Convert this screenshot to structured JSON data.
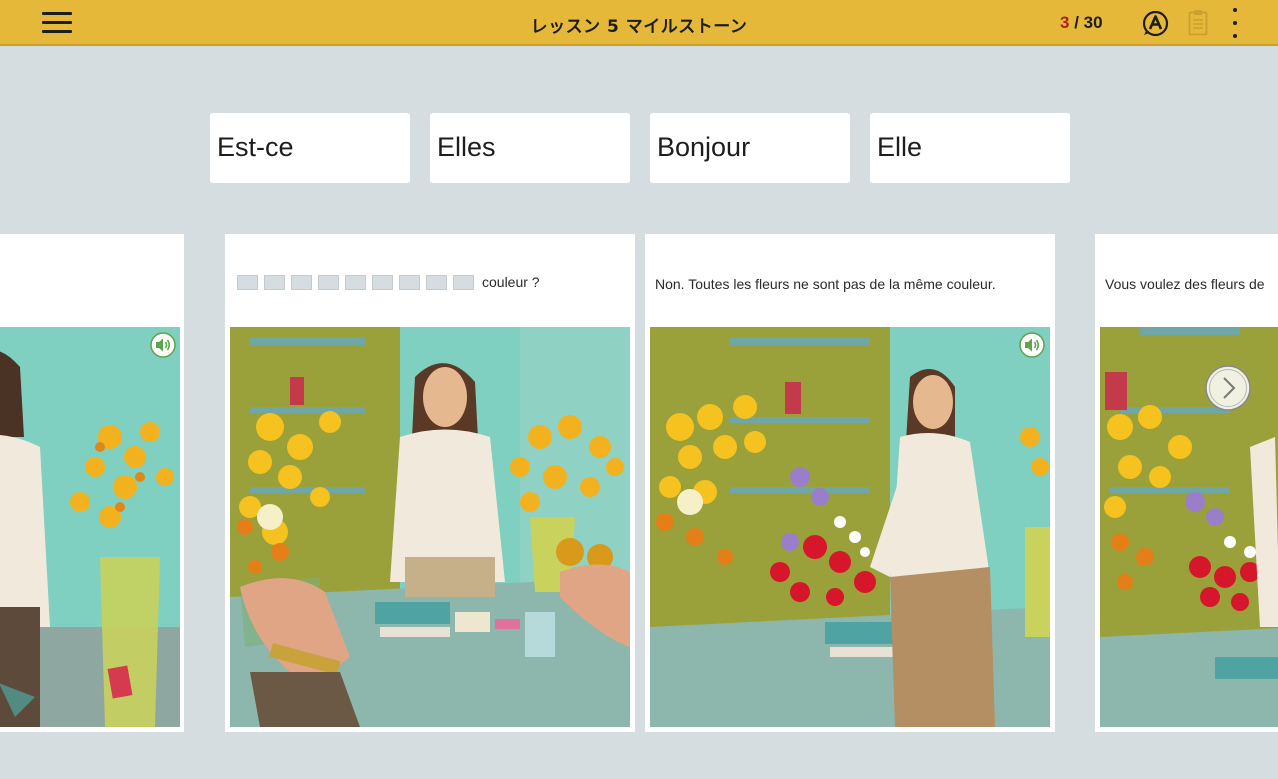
{
  "header": {
    "title": "レッスン 5 マイルストーン",
    "progress_current": "3",
    "progress_separator": " / ",
    "progress_total": "30",
    "menu_icon": "hamburger-menu-icon",
    "answer_icon": "circled-a-icon",
    "clipboard_icon": "clipboard-icon",
    "more_icon": "vertical-dots-icon"
  },
  "choices": [
    "Est-ce",
    "Elles",
    "Bonjour",
    "Elle"
  ],
  "cards": [
    {
      "caption": ""
    },
    {
      "caption_tail": "couleur ?"
    },
    {
      "caption": "Non. Toutes les fleurs ne sont pas de la même couleur."
    },
    {
      "caption": "Vous voulez des fleurs de"
    }
  ],
  "colors": {
    "topbar": "#e5b83a",
    "background": "#d6dde0",
    "progress_current": "#b0201c",
    "wall_teal": "#7fd0c0",
    "wall_olive": "#9aa13a",
    "speaker_green": "#5fa34a"
  },
  "icons": {
    "audio": "speaker-icon",
    "next": "chevron-right-icon"
  }
}
